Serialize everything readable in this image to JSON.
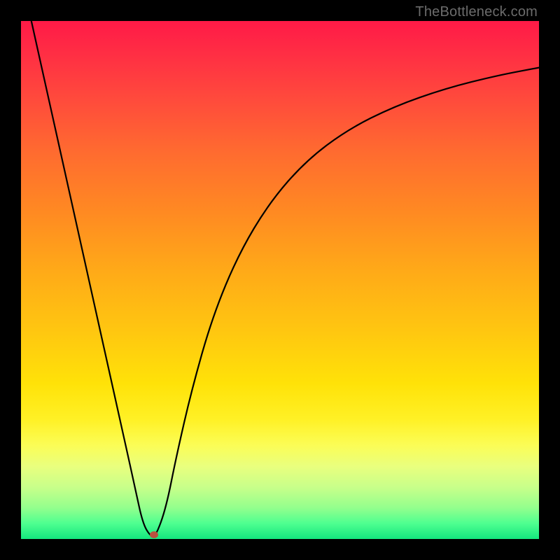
{
  "watermark": "TheBottleneck.com",
  "chart_data": {
    "type": "line",
    "title": "",
    "xlabel": "",
    "ylabel": "",
    "xlim": [
      0,
      100
    ],
    "ylim": [
      0,
      100
    ],
    "series": [
      {
        "name": "curve",
        "x": [
          2,
          6,
          10,
          14,
          18,
          20,
          22,
          23.5,
          25,
          26,
          28,
          30,
          33,
          37,
          42,
          48,
          55,
          63,
          72,
          82,
          92,
          100
        ],
        "y": [
          100,
          82,
          64,
          46,
          28,
          19,
          10,
          3,
          0.5,
          0.5,
          6,
          16,
          29,
          43,
          55,
          65,
          73,
          79,
          83.5,
          87,
          89.5,
          91
        ]
      }
    ],
    "marker": {
      "x": 25.7,
      "y": 0.8
    },
    "background_gradient": {
      "top": "#ff1a47",
      "bottom": "#14e67e"
    }
  }
}
